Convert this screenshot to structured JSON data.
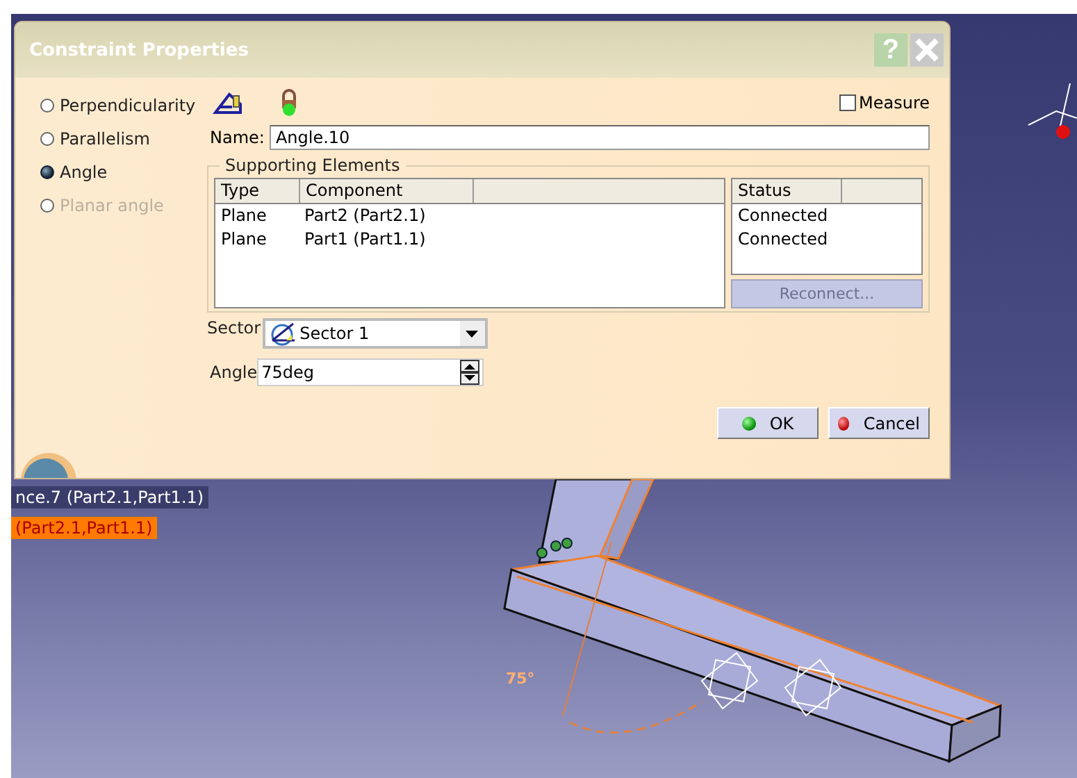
{
  "window": {
    "title": "Constraint Properties",
    "help": "?"
  },
  "constraint_types": [
    {
      "label": "Perpendicularity",
      "selected": false,
      "disabled": false
    },
    {
      "label": "Parallelism",
      "selected": false,
      "disabled": false
    },
    {
      "label": "Angle",
      "selected": true,
      "disabled": false
    },
    {
      "label": "Planar angle",
      "selected": false,
      "disabled": true
    }
  ],
  "measure": {
    "label": "Measure",
    "checked": false
  },
  "name": {
    "label": "Name:",
    "value": "Angle.10"
  },
  "supporting_elements": {
    "title": "Supporting Elements",
    "columns": [
      "Type",
      "Component"
    ],
    "rows": [
      {
        "type": "Plane",
        "component": "Part2 (Part2.1)"
      },
      {
        "type": "Plane",
        "component": "Part1 (Part1.1)"
      }
    ],
    "status_column": "Status",
    "statuses": [
      "Connected",
      "Connected"
    ],
    "reconnect": {
      "label": "Reconnect...",
      "disabled": true
    }
  },
  "sector": {
    "label": "Sector",
    "value": "Sector 1"
  },
  "angle": {
    "label": "Angle",
    "value": "75deg"
  },
  "buttons": [
    {
      "label": "OK",
      "kind": "ok"
    },
    {
      "label": "Cancel",
      "kind": "cancel"
    }
  ],
  "tree": [
    {
      "label": "nce.7 (Part2.1,Part1.1)",
      "selected": false
    },
    {
      "label": "(Part2.1,Part1.1)",
      "selected": true
    }
  ],
  "model": {
    "angle_label": "75°"
  }
}
